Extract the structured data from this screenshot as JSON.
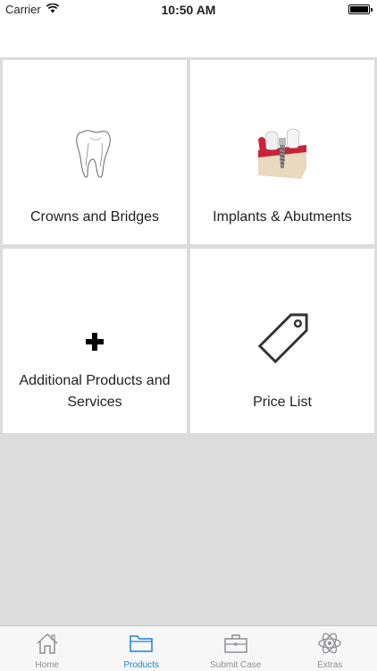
{
  "status_bar": {
    "carrier": "Carrier",
    "time": "10:50 AM"
  },
  "tiles": [
    {
      "label": "Crowns and Bridges",
      "icon": "tooth-icon"
    },
    {
      "label": "Implants & Abutments",
      "icon": "dental-implant-icon"
    },
    {
      "label": "Additional Products and Services",
      "icon": "plus-icon"
    },
    {
      "label": "Price List",
      "icon": "price-tag-icon"
    }
  ],
  "tab_bar": {
    "active": "Products",
    "tabs": [
      {
        "label": "Home",
        "icon": "home-icon"
      },
      {
        "label": "Products",
        "icon": "folder-icon"
      },
      {
        "label": "Submit Case",
        "icon": "briefcase-icon"
      },
      {
        "label": "Extras",
        "icon": "atom-icon"
      }
    ]
  },
  "colors": {
    "accent": "#1a82d4",
    "inactive_tab": "#8e8e93",
    "grid_background": "#dcdcdc",
    "implant_gum": "#c8233a"
  }
}
